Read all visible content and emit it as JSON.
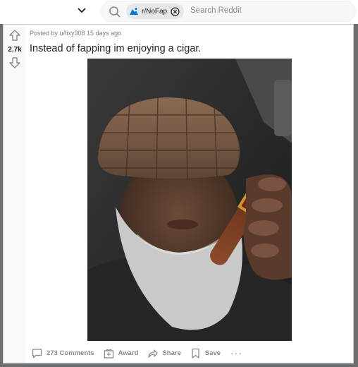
{
  "header": {
    "search": {
      "community_chip": "r/NoFap",
      "placeholder": "Search Reddit"
    }
  },
  "post": {
    "score": "2.7k",
    "meta": "Posted by u/fixy308 15 days ago",
    "title": "Instead of fapping im enjoying a cigar.",
    "actions": {
      "comments": "273 Comments",
      "award": "Award",
      "share": "Share",
      "save": "Save",
      "more": "···"
    }
  },
  "colors": {
    "page_bg": "#dae0e6",
    "card_bg": "#ffffff",
    "muted_text": "#878a8c"
  },
  "icons": [
    "chevron-down-icon",
    "search-icon",
    "community-icon",
    "clear-icon",
    "upvote-icon",
    "downvote-icon",
    "comment-icon",
    "award-icon",
    "share-icon",
    "save-icon"
  ]
}
